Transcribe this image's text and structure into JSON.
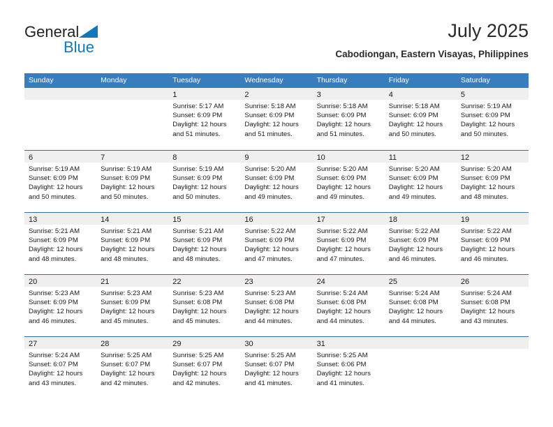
{
  "brand": {
    "line1": "General",
    "line2": "Blue",
    "triangle_color": "#1278be",
    "text_color": "#231f20"
  },
  "header": {
    "title": "July 2025",
    "subtitle": "Cabodiongan, Eastern Visayas, Philippines"
  },
  "theme": {
    "header_blue": "#3a7dbe",
    "divider_blue": "#2f6fab",
    "daynum_band": "#efefef",
    "text": "#1a1a1a"
  },
  "weekdays": [
    "Sunday",
    "Monday",
    "Tuesday",
    "Wednesday",
    "Thursday",
    "Friday",
    "Saturday"
  ],
  "weeks": [
    [
      {
        "day": "",
        "sunrise": "",
        "sunset": "",
        "daylight": ""
      },
      {
        "day": "",
        "sunrise": "",
        "sunset": "",
        "daylight": ""
      },
      {
        "day": "1",
        "sunrise": "Sunrise: 5:17 AM",
        "sunset": "Sunset: 6:09 PM",
        "daylight": "Daylight: 12 hours and 51 minutes."
      },
      {
        "day": "2",
        "sunrise": "Sunrise: 5:18 AM",
        "sunset": "Sunset: 6:09 PM",
        "daylight": "Daylight: 12 hours and 51 minutes."
      },
      {
        "day": "3",
        "sunrise": "Sunrise: 5:18 AM",
        "sunset": "Sunset: 6:09 PM",
        "daylight": "Daylight: 12 hours and 51 minutes."
      },
      {
        "day": "4",
        "sunrise": "Sunrise: 5:18 AM",
        "sunset": "Sunset: 6:09 PM",
        "daylight": "Daylight: 12 hours and 50 minutes."
      },
      {
        "day": "5",
        "sunrise": "Sunrise: 5:19 AM",
        "sunset": "Sunset: 6:09 PM",
        "daylight": "Daylight: 12 hours and 50 minutes."
      }
    ],
    [
      {
        "day": "6",
        "sunrise": "Sunrise: 5:19 AM",
        "sunset": "Sunset: 6:09 PM",
        "daylight": "Daylight: 12 hours and 50 minutes."
      },
      {
        "day": "7",
        "sunrise": "Sunrise: 5:19 AM",
        "sunset": "Sunset: 6:09 PM",
        "daylight": "Daylight: 12 hours and 50 minutes."
      },
      {
        "day": "8",
        "sunrise": "Sunrise: 5:19 AM",
        "sunset": "Sunset: 6:09 PM",
        "daylight": "Daylight: 12 hours and 50 minutes."
      },
      {
        "day": "9",
        "sunrise": "Sunrise: 5:20 AM",
        "sunset": "Sunset: 6:09 PM",
        "daylight": "Daylight: 12 hours and 49 minutes."
      },
      {
        "day": "10",
        "sunrise": "Sunrise: 5:20 AM",
        "sunset": "Sunset: 6:09 PM",
        "daylight": "Daylight: 12 hours and 49 minutes."
      },
      {
        "day": "11",
        "sunrise": "Sunrise: 5:20 AM",
        "sunset": "Sunset: 6:09 PM",
        "daylight": "Daylight: 12 hours and 49 minutes."
      },
      {
        "day": "12",
        "sunrise": "Sunrise: 5:20 AM",
        "sunset": "Sunset: 6:09 PM",
        "daylight": "Daylight: 12 hours and 48 minutes."
      }
    ],
    [
      {
        "day": "13",
        "sunrise": "Sunrise: 5:21 AM",
        "sunset": "Sunset: 6:09 PM",
        "daylight": "Daylight: 12 hours and 48 minutes."
      },
      {
        "day": "14",
        "sunrise": "Sunrise: 5:21 AM",
        "sunset": "Sunset: 6:09 PM",
        "daylight": "Daylight: 12 hours and 48 minutes."
      },
      {
        "day": "15",
        "sunrise": "Sunrise: 5:21 AM",
        "sunset": "Sunset: 6:09 PM",
        "daylight": "Daylight: 12 hours and 48 minutes."
      },
      {
        "day": "16",
        "sunrise": "Sunrise: 5:22 AM",
        "sunset": "Sunset: 6:09 PM",
        "daylight": "Daylight: 12 hours and 47 minutes."
      },
      {
        "day": "17",
        "sunrise": "Sunrise: 5:22 AM",
        "sunset": "Sunset: 6:09 PM",
        "daylight": "Daylight: 12 hours and 47 minutes."
      },
      {
        "day": "18",
        "sunrise": "Sunrise: 5:22 AM",
        "sunset": "Sunset: 6:09 PM",
        "daylight": "Daylight: 12 hours and 46 minutes."
      },
      {
        "day": "19",
        "sunrise": "Sunrise: 5:22 AM",
        "sunset": "Sunset: 6:09 PM",
        "daylight": "Daylight: 12 hours and 46 minutes."
      }
    ],
    [
      {
        "day": "20",
        "sunrise": "Sunrise: 5:23 AM",
        "sunset": "Sunset: 6:09 PM",
        "daylight": "Daylight: 12 hours and 46 minutes."
      },
      {
        "day": "21",
        "sunrise": "Sunrise: 5:23 AM",
        "sunset": "Sunset: 6:09 PM",
        "daylight": "Daylight: 12 hours and 45 minutes."
      },
      {
        "day": "22",
        "sunrise": "Sunrise: 5:23 AM",
        "sunset": "Sunset: 6:08 PM",
        "daylight": "Daylight: 12 hours and 45 minutes."
      },
      {
        "day": "23",
        "sunrise": "Sunrise: 5:23 AM",
        "sunset": "Sunset: 6:08 PM",
        "daylight": "Daylight: 12 hours and 44 minutes."
      },
      {
        "day": "24",
        "sunrise": "Sunrise: 5:24 AM",
        "sunset": "Sunset: 6:08 PM",
        "daylight": "Daylight: 12 hours and 44 minutes."
      },
      {
        "day": "25",
        "sunrise": "Sunrise: 5:24 AM",
        "sunset": "Sunset: 6:08 PM",
        "daylight": "Daylight: 12 hours and 44 minutes."
      },
      {
        "day": "26",
        "sunrise": "Sunrise: 5:24 AM",
        "sunset": "Sunset: 6:08 PM",
        "daylight": "Daylight: 12 hours and 43 minutes."
      }
    ],
    [
      {
        "day": "27",
        "sunrise": "Sunrise: 5:24 AM",
        "sunset": "Sunset: 6:07 PM",
        "daylight": "Daylight: 12 hours and 43 minutes."
      },
      {
        "day": "28",
        "sunrise": "Sunrise: 5:25 AM",
        "sunset": "Sunset: 6:07 PM",
        "daylight": "Daylight: 12 hours and 42 minutes."
      },
      {
        "day": "29",
        "sunrise": "Sunrise: 5:25 AM",
        "sunset": "Sunset: 6:07 PM",
        "daylight": "Daylight: 12 hours and 42 minutes."
      },
      {
        "day": "30",
        "sunrise": "Sunrise: 5:25 AM",
        "sunset": "Sunset: 6:07 PM",
        "daylight": "Daylight: 12 hours and 41 minutes."
      },
      {
        "day": "31",
        "sunrise": "Sunrise: 5:25 AM",
        "sunset": "Sunset: 6:06 PM",
        "daylight": "Daylight: 12 hours and 41 minutes."
      },
      {
        "day": "",
        "sunrise": "",
        "sunset": "",
        "daylight": ""
      },
      {
        "day": "",
        "sunrise": "",
        "sunset": "",
        "daylight": ""
      }
    ]
  ]
}
